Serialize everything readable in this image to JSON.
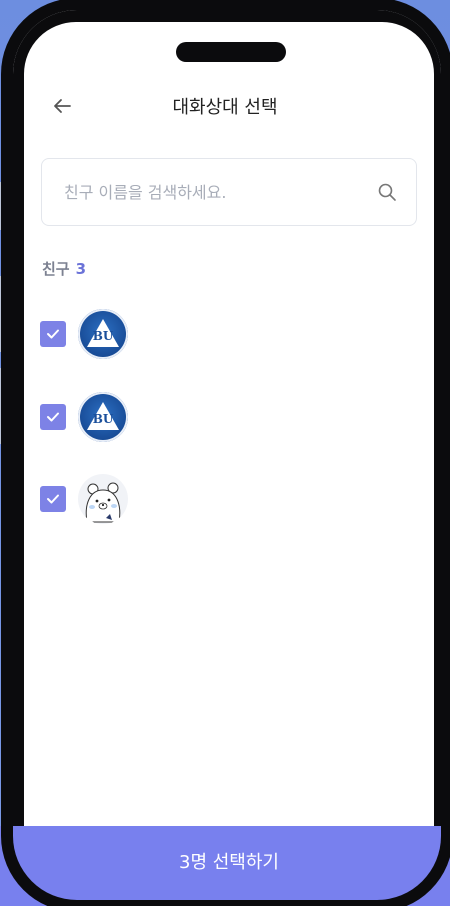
{
  "header": {
    "title": "대화상대 선택",
    "back_icon": "arrow-left-icon"
  },
  "search": {
    "placeholder": "친구 이름을 검색하세요.",
    "value": "",
    "icon": "search-icon"
  },
  "friends": {
    "label": "친구",
    "count": "3"
  },
  "friend_list": [
    {
      "avatar": "bu-logo",
      "avatar_text": "BU",
      "checked": true
    },
    {
      "avatar": "bu-logo",
      "avatar_text": "BU",
      "checked": true
    },
    {
      "avatar": "bear-sticker",
      "checked": true
    }
  ],
  "footer": {
    "confirm_label": "3명 선택하기"
  },
  "colors": {
    "accent": "#7880ee",
    "checkbox": "#7d82e6",
    "count": "#6b73d8"
  }
}
